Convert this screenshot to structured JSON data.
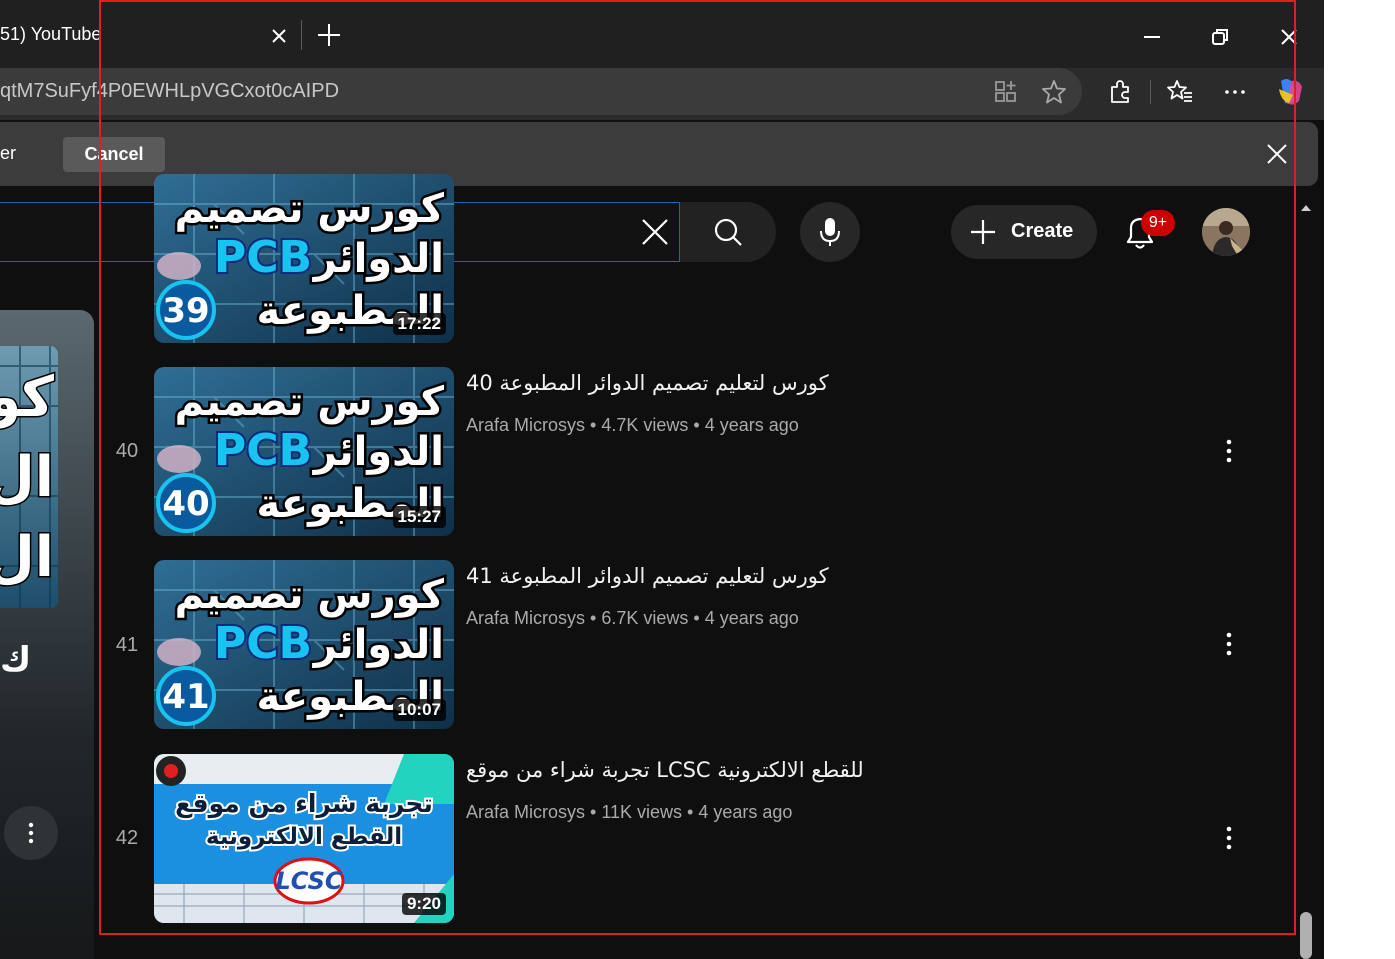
{
  "browser": {
    "tab_title": "51) YouTube",
    "url": "qtM7SuFyf4P0EWHLpVGCxot0cAIPD",
    "infobar_text": "er",
    "infobar_cancel": "Cancel"
  },
  "masthead": {
    "search_value": "",
    "create_label": "Create",
    "notification_count": "9+"
  },
  "playlist": {
    "rows": [
      {
        "index": "",
        "title": "",
        "channel": "",
        "views": "",
        "age": "",
        "duration": "17:22",
        "thumb_number": "39"
      },
      {
        "index": "40",
        "title": "كورس لتعليم تصميم الدوائر المطبوعة 40",
        "channel": "Arafa Microsys",
        "views": "4.7K views",
        "age": "4 years ago",
        "duration": "15:27",
        "thumb_number": "40"
      },
      {
        "index": "41",
        "title": "كورس لتعليم تصميم الدوائر المطبوعة 41",
        "channel": "Arafa Microsys",
        "views": "6.7K views",
        "age": "4 years ago",
        "duration": "10:07",
        "thumb_number": "41"
      },
      {
        "index": "42",
        "title": "تجربة شراء من موقع LCSC للقطع الالكترونية",
        "channel": "Arafa Microsys",
        "views": "11K views",
        "age": "4 years ago",
        "duration": "9:20",
        "thumb_number": ""
      }
    ],
    "thumb_text": {
      "line1": "كورس تصميم",
      "line2a": "PCB",
      "line2b": "الدوائر",
      "line3": "المطبوعة",
      "lcsc_line1": "تجربة شراء من موقع",
      "lcsc_line2": "القطع الالكترونية",
      "lcsc_logo": "LCSC"
    },
    "left_panel_glyph": "ك"
  },
  "colors": {
    "accent_blue": "#1c62b9",
    "badge_red": "#cc0000",
    "selection_red": "#e02020",
    "pcb_cyan": "#19c3f0"
  }
}
